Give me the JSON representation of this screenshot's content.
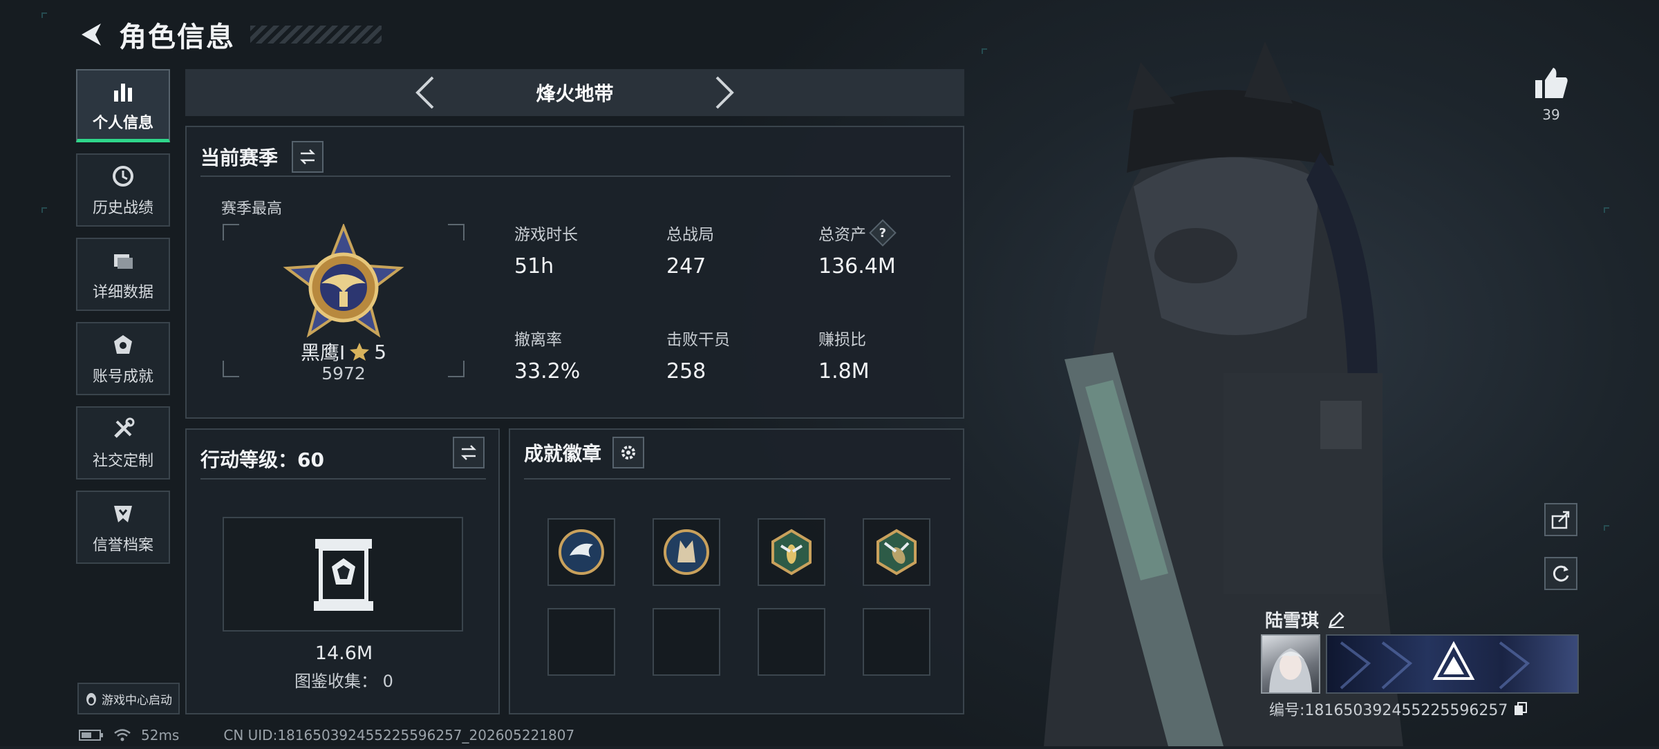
{
  "header": {
    "title": "角色信息"
  },
  "nav": [
    {
      "label": "个人信息",
      "icon": "bar-chart-icon"
    },
    {
      "label": "历史战绩",
      "icon": "history-icon"
    },
    {
      "label": "详细数据",
      "icon": "folder-icon"
    },
    {
      "label": "账号成就",
      "icon": "medal-icon"
    },
    {
      "label": "社交定制",
      "icon": "tools-icon"
    },
    {
      "label": "信誉档案",
      "icon": "shield-icon"
    }
  ],
  "game_tab": {
    "name": "烽火地带"
  },
  "season": {
    "title": "当前赛季",
    "best_label": "赛季最高",
    "rank_name": "黑鹰I",
    "rank_stars": "5",
    "rank_score": "5972",
    "stats": [
      {
        "label": "游戏时长",
        "value": "51h"
      },
      {
        "label": "总战局",
        "value": "247"
      },
      {
        "label": "总资产",
        "value": "136.4M",
        "has_help": true
      },
      {
        "label": "撤离率",
        "value": "33.2%"
      },
      {
        "label": "击败干员",
        "value": "258"
      },
      {
        "label": "赚损比",
        "value": "1.8M"
      }
    ],
    "help_glyph": "?"
  },
  "action_level": {
    "title": "行动等级：60",
    "value": "14.6M",
    "collection": "图鉴收集： 0"
  },
  "achievements": {
    "title": "成就徽章",
    "badges": [
      "eagle-badge-icon",
      "wolf-badge-icon",
      "wasp-badge-icon",
      "hornet-badge-icon",
      "",
      "",
      "",
      ""
    ]
  },
  "player": {
    "likes": "39",
    "name": "陆雪琪",
    "id": "编号:181650392455225596257"
  },
  "footer": {
    "game_center": "游戏中心启动",
    "ping": "52ms",
    "uid": "CN UID:181650392455225596257_202605221807"
  },
  "colors": {
    "accent": "#2fd68a",
    "panel": "#1c232a",
    "border": "#3a444c"
  }
}
